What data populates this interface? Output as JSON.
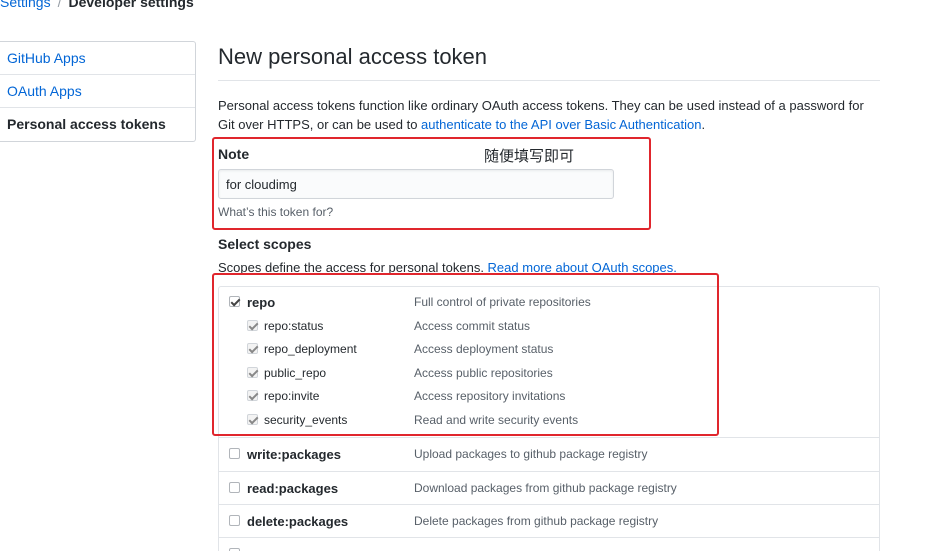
{
  "breadcrumb": {
    "parent": "Settings",
    "current": "Developer settings"
  },
  "sidebar": {
    "items": [
      {
        "label": "GitHub Apps"
      },
      {
        "label": "OAuth Apps"
      },
      {
        "label": "Personal access tokens"
      }
    ]
  },
  "page": {
    "title": "New personal access token",
    "intro_text": "Personal access tokens function like ordinary OAuth access tokens. They can be used instead of a password for Git over HTTPS, or can be used to ",
    "intro_link": "authenticate to the API over Basic Authentication",
    "intro_end": "."
  },
  "note": {
    "label": "Note",
    "value": "for cloudimg",
    "hint": "What’s this token for?",
    "annotation": "随便填写即可"
  },
  "scopes": {
    "title": "Select scopes",
    "desc_text": "Scopes define the access for personal tokens. ",
    "desc_link": "Read more about OAuth scopes.",
    "repo": {
      "name": "repo",
      "desc": "Full control of private repositories",
      "checked": true
    },
    "repo_children": [
      {
        "name": "repo:status",
        "desc": "Access commit status"
      },
      {
        "name": "repo_deployment",
        "desc": "Access deployment status"
      },
      {
        "name": "public_repo",
        "desc": "Access public repositories"
      },
      {
        "name": "repo:invite",
        "desc": "Access repository invitations"
      },
      {
        "name": "security_events",
        "desc": "Read and write security events"
      }
    ],
    "others": [
      {
        "name": "write:packages",
        "desc": "Upload packages to github package registry"
      },
      {
        "name": "read:packages",
        "desc": "Download packages from github package registry"
      },
      {
        "name": "delete:packages",
        "desc": "Delete packages from github package registry"
      }
    ]
  },
  "colors": {
    "accent_link": "#0366d6",
    "highlight_box": "#e0262d"
  }
}
